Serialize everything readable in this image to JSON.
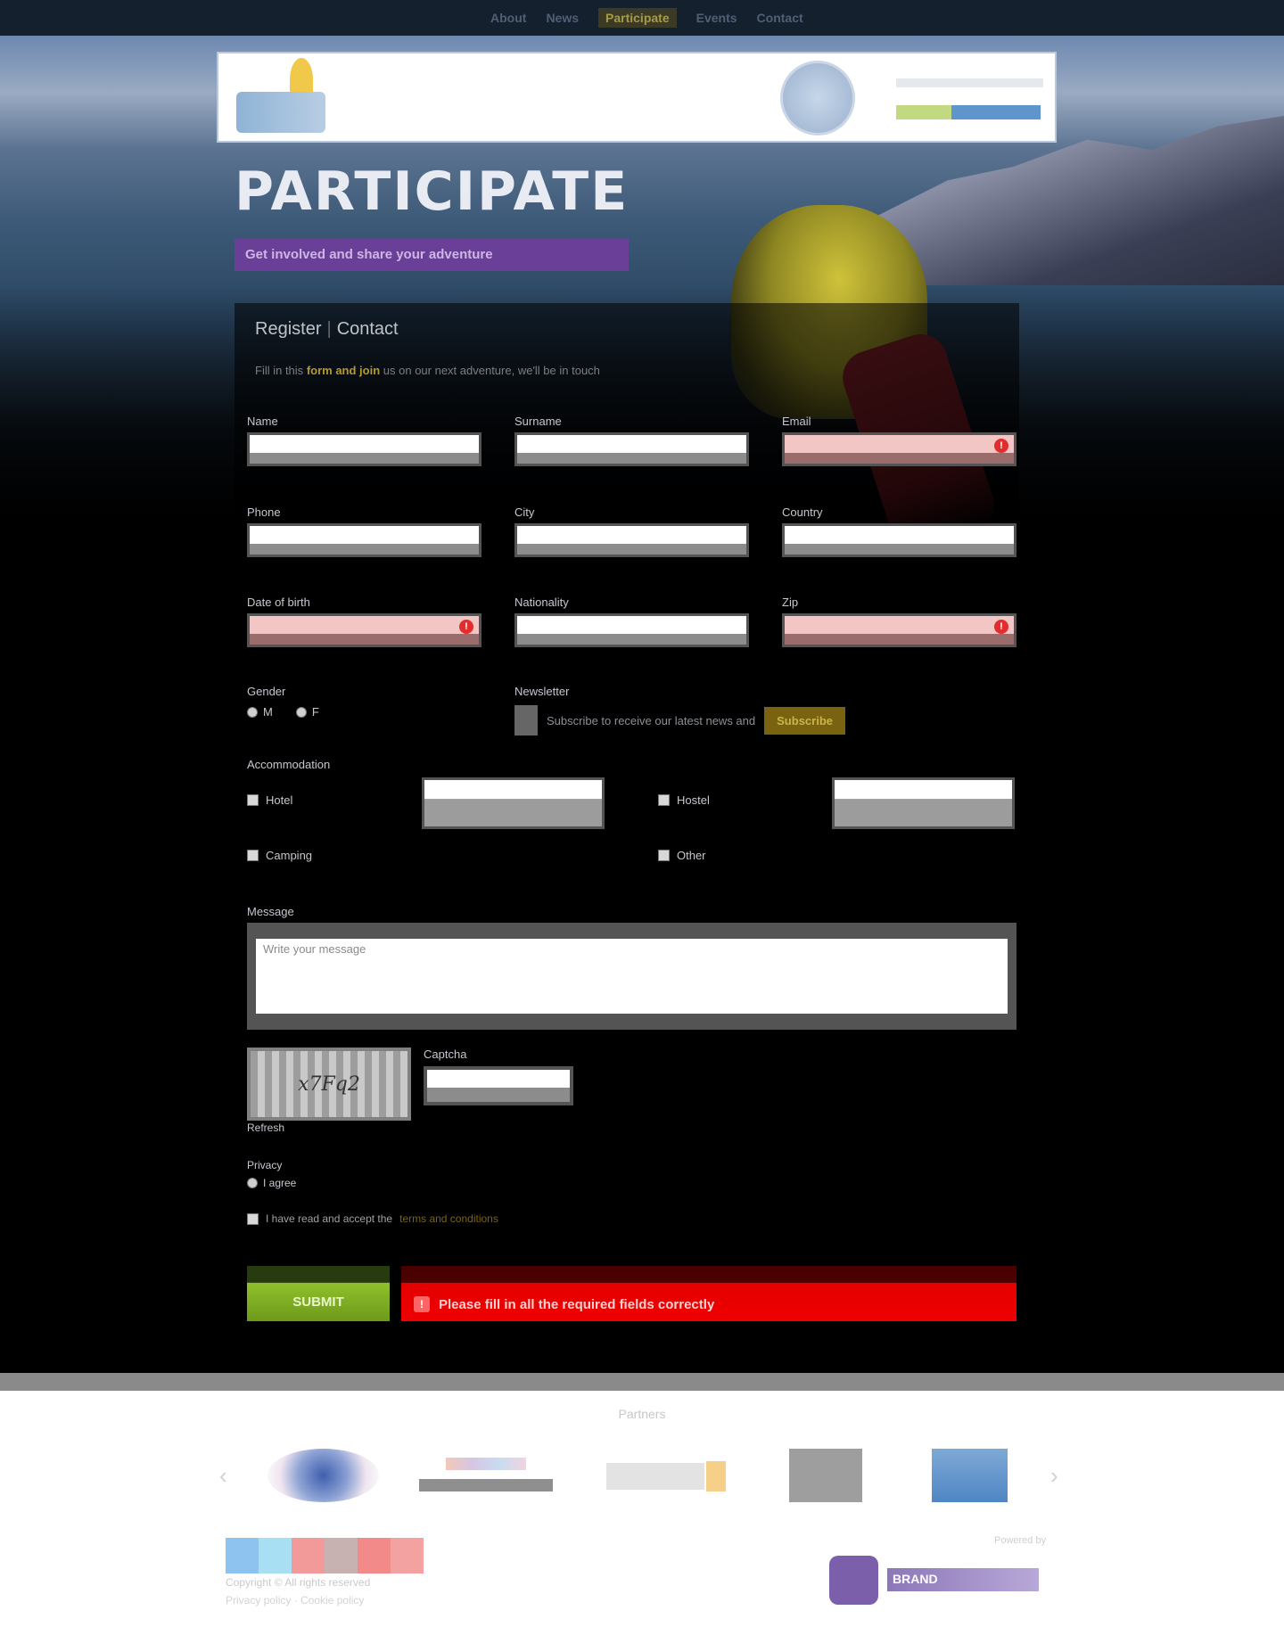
{
  "nav": {
    "links": [
      "About",
      "News",
      "Participate",
      "Events",
      "Contact"
    ],
    "active_index": 2
  },
  "header": {
    "logo_alt": "site-logo",
    "seal_alt": "partner-seal",
    "sponsor_alt": "sponsor-logo"
  },
  "hero": {
    "title": "PARTICIPATE",
    "subtitle": "Get involved and share your adventure"
  },
  "form": {
    "heading": "Register",
    "heading_sep": "|",
    "heading_sub": "Contact",
    "intro_text": "Fill in this",
    "intro_highlight": "form and join",
    "intro_rest": "us on our next adventure, we'll be in touch",
    "fields": {
      "first_name": {
        "label": "Name"
      },
      "last_name": {
        "label": "Surname"
      },
      "email": {
        "label": "Email"
      },
      "phone": {
        "label": "Phone"
      },
      "city": {
        "label": "City"
      },
      "country": {
        "label": "Country"
      },
      "birth_date": {
        "label": "Date of birth"
      },
      "nationality": {
        "label": "Nationality"
      },
      "zip": {
        "label": "Zip"
      }
    },
    "gender": {
      "label": "Gender",
      "options": [
        "M",
        "F"
      ]
    },
    "newsletter": {
      "label": "Newsletter",
      "text": "Subscribe to receive our latest news and",
      "button": "Subscribe"
    },
    "accommodation": {
      "label": "Accommodation",
      "options": [
        "Hotel",
        "Camping",
        "Hostel",
        "Other"
      ]
    },
    "message": {
      "label": "Message",
      "placeholder": "Write your message"
    },
    "captcha": {
      "image_text": "x7Fq2",
      "label": "Captcha",
      "refresh": "Refresh"
    },
    "privacy": {
      "label": "Privacy",
      "option": "I agree"
    },
    "terms": {
      "text": "I have read and accept the",
      "link": "terms and conditions"
    },
    "submit": "SUBMIT",
    "error": {
      "icon": "!",
      "message": "Please fill in all the required fields correctly"
    }
  },
  "partners": {
    "title": "Partners",
    "prev": "‹",
    "next": "›"
  },
  "footer": {
    "social": [
      "twitter",
      "facebook",
      "youtube",
      "instagram",
      "flickr",
      "pinterest"
    ],
    "line1": "Copyright © All rights reserved",
    "line2": "Privacy policy · Cookie policy",
    "powered": "Powered by",
    "brand": "BRAND"
  },
  "colors": {
    "accent_purple": "#6a3f97",
    "submit_green": "#8fbf2c",
    "error_red": "#f00000",
    "highlight_gold": "#b49b2a"
  }
}
